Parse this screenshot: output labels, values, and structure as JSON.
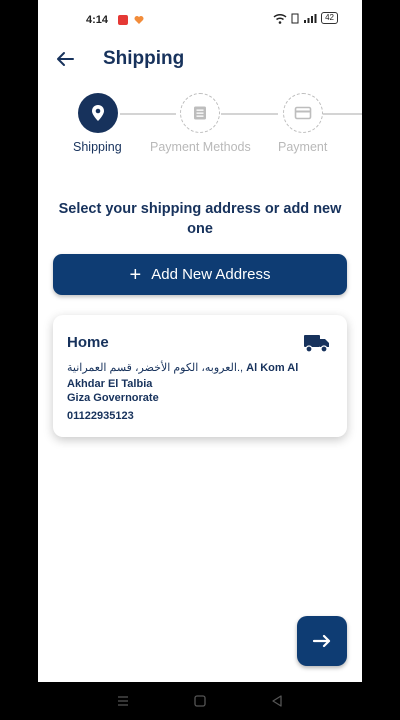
{
  "status_bar": {
    "time": "4:14",
    "battery": "42"
  },
  "header": {
    "title": "Shipping"
  },
  "stepper": {
    "steps": [
      {
        "label": "Shipping",
        "active": true
      },
      {
        "label": "Payment Methods",
        "active": false
      },
      {
        "label": "Payment",
        "active": false
      }
    ]
  },
  "prompt": "Select your shipping address or add new one",
  "add_address_label": "Add New Address",
  "address_card": {
    "title": "Home",
    "line_arabic": "العروبه، الكوم الأخضر، قسم العمرانية.,",
    "line_latin": " Al Kom Al Akhdar El Talbia",
    "governorate": "Giza Governorate",
    "phone": "01122935123"
  },
  "colors": {
    "primary": "#0e3c73",
    "title": "#17325c",
    "inactive": "#b9b9b9"
  },
  "icons": [
    "back-arrow-icon",
    "location-pin-icon",
    "list-icon",
    "card-icon",
    "truck-icon",
    "plus-icon",
    "arrow-right-icon"
  ]
}
